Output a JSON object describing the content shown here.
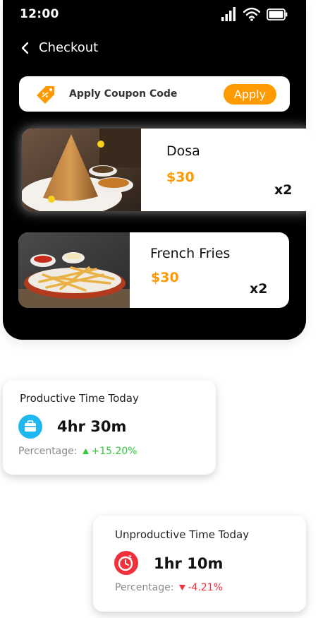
{
  "status_bar": {
    "time": "12:00"
  },
  "nav": {
    "title": "Checkout"
  },
  "coupon": {
    "label": "Apply Coupon Code",
    "button": "Apply"
  },
  "cart": {
    "items": [
      {
        "name": "Dosa",
        "price": "$30",
        "quantity": "x2"
      },
      {
        "name": "French Fries",
        "price": "$30",
        "quantity": "x2"
      }
    ]
  },
  "productive": {
    "title": "Productive Time Today",
    "value": "4hr 30m",
    "percentage_label": "Percentage:",
    "percentage_value": "+15.20%"
  },
  "unproductive": {
    "title": "Unproductive Time Today",
    "value": "1hr 10m",
    "percentage_label": "Percentage:",
    "percentage_value": "-4.21%"
  },
  "colors": {
    "accent": "#ff9a00",
    "background": "#000000",
    "positive": "#34c93a",
    "negative": "#f0303a",
    "productive_icon": "#1fb7f0",
    "unproductive_icon": "#f0303a"
  },
  "icons": {
    "signal": "signal-icon",
    "wifi": "wifi-icon",
    "battery": "battery-icon",
    "back": "chevron-left-icon",
    "coupon": "coupon-tag-icon",
    "productive": "briefcase-icon",
    "unproductive": "sleep-clock-icon"
  }
}
